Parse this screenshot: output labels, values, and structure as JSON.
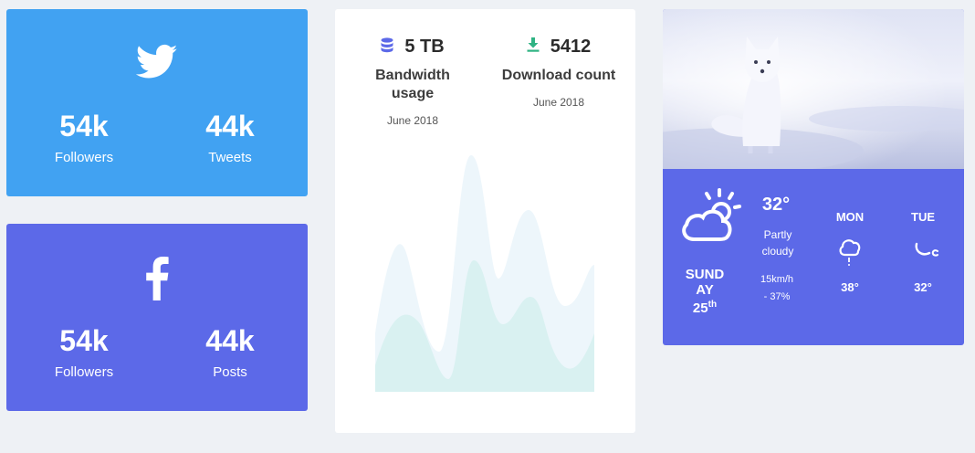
{
  "twitter": {
    "followers_value": "54k",
    "followers_label": "Followers",
    "tweets_value": "44k",
    "tweets_label": "Tweets",
    "brand_color": "#41a2f2",
    "icon": "twitter-icon"
  },
  "facebook": {
    "followers_value": "54k",
    "followers_label": "Followers",
    "posts_value": "44k",
    "posts_label": "Posts",
    "brand_color": "#5c69e8",
    "icon": "facebook-icon"
  },
  "bandwidth": {
    "value": "5 TB",
    "title": "Bandwidth usage",
    "date": "June 2018",
    "icon": "database-icon"
  },
  "downloads": {
    "value": "5412",
    "title": "Download count",
    "date": "June 2018",
    "icon": "download-icon"
  },
  "weather": {
    "temp": "32°",
    "condition": "Partly cloudy",
    "wind": "15km/h",
    "humidity": "- 37%",
    "day": "SUNDAY",
    "date": "25",
    "date_suffix": "th",
    "forecast": [
      {
        "day": "MON",
        "temp": "38°",
        "icon": "rain-cloud-icon"
      },
      {
        "day": "TUE",
        "temp": "32°",
        "icon": "moon-icon"
      }
    ],
    "accent_color": "#5c69e8"
  }
}
